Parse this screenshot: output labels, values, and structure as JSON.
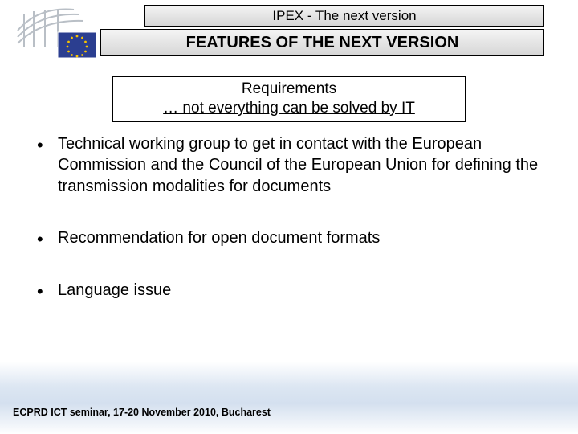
{
  "header": {
    "title_small": "IPEX - The next version",
    "title_large": "FEATURES OF THE NEXT VERSION"
  },
  "requirements": {
    "line1": "Requirements",
    "line2": "… not everything can be solved by IT"
  },
  "bullets": [
    "Technical working group to get in contact with the European Commission and the Council of the European Union for defining the transmission modalities for documents",
    "Recommendation for open document formats",
    "Language issue"
  ],
  "footer": {
    "text": "ECPRD ICT seminar, 17-20 November 2010, Bucharest"
  },
  "colors": {
    "eu_blue": "#2b3e90",
    "eu_gold": "#f8c300"
  }
}
